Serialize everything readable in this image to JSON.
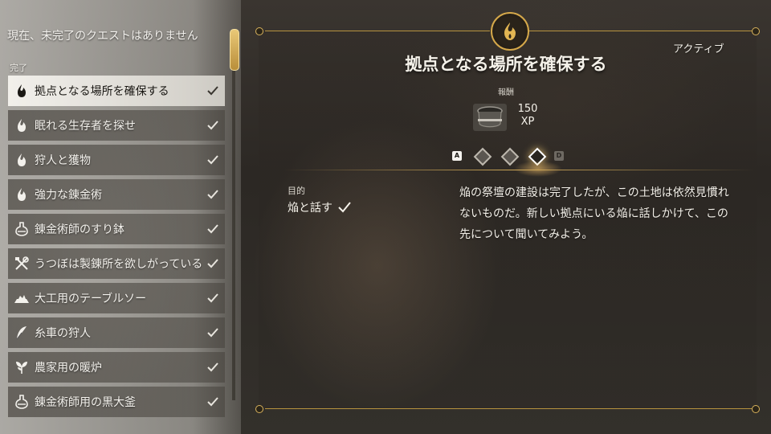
{
  "status_text": "現在、未完了のクエストはありません",
  "section_label": "完了",
  "quests": [
    {
      "label": "拠点となる場所を確保する",
      "icon": "flame-icon",
      "selected": true
    },
    {
      "label": "眠れる生存者を探せ",
      "icon": "flame-icon"
    },
    {
      "label": "狩人と獲物",
      "icon": "flame-icon"
    },
    {
      "label": "強力な錬金術",
      "icon": "flame-icon"
    },
    {
      "label": "錬金術師のすり鉢",
      "icon": "flask-icon"
    },
    {
      "label": "うつぼは製錬所を欲しがっている",
      "icon": "tools-icon"
    },
    {
      "label": "大工用のテーブルソー",
      "icon": "saw-icon"
    },
    {
      "label": "糸車の狩人",
      "icon": "feather-icon"
    },
    {
      "label": "農家用の暖炉",
      "icon": "leaf-icon"
    },
    {
      "label": "錬金術師用の黒大釜",
      "icon": "flask-icon"
    }
  ],
  "detail": {
    "status": "アクティブ",
    "title": "拠点となる場所を確保する",
    "reward_label": "報酬",
    "reward_amount": "150",
    "reward_unit": "XP",
    "nav_left_key": "A",
    "nav_right_key": "D",
    "pages": 3,
    "active_page": 3,
    "objective_heading": "目的",
    "objective": "焔と話す",
    "description": "焔の祭壇の建設は完了したが、この土地は依然見慣れないものだ。新しい拠点にいる焔に話しかけて、この先について聞いてみよう。"
  },
  "colors": {
    "accent_gold": "#d5a84a",
    "selected_bg": "#f3f1ec"
  }
}
